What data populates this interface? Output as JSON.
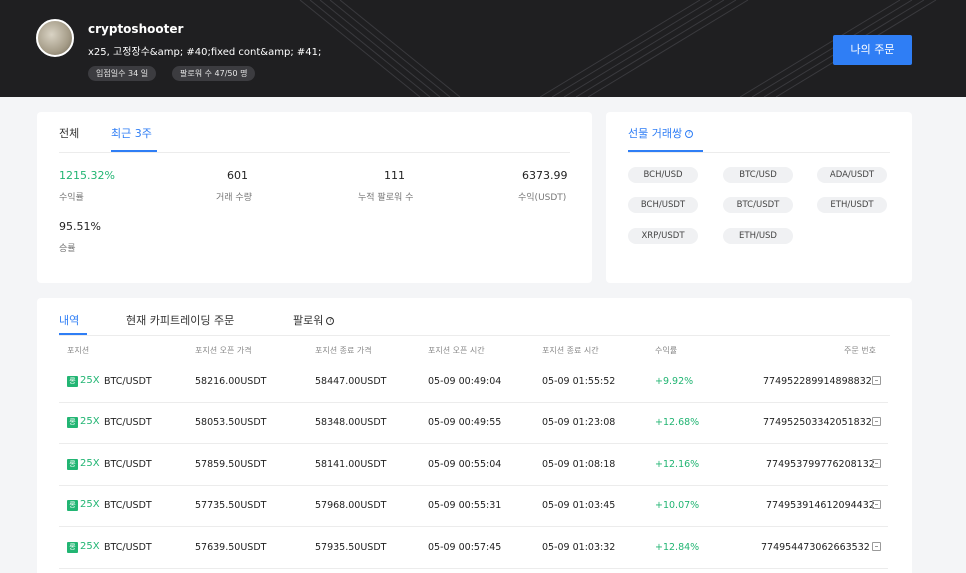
{
  "header": {
    "username": "cryptoshooter",
    "tagline": "x25, 고정장수&amp; #40;fixed cont&amp; #41;",
    "badges": [
      "입점일수 34 일",
      "팔로워 수 47/50 명"
    ],
    "my_orders_button": "나의 주문",
    "accent_color": "#2f7ef5"
  },
  "stats_card": {
    "tabs": [
      "전체",
      "최근 3주"
    ],
    "active_tab": "최근 3주",
    "metrics": [
      {
        "value": "1215.32%",
        "label": "수익률"
      },
      {
        "value": "601",
        "label": "거래 수량"
      },
      {
        "value": "111",
        "label": "누적 팔로워 수"
      },
      {
        "value": "6373.99",
        "label": "수익(USDT)"
      },
      {
        "value": "95.51%",
        "label": "승률"
      }
    ]
  },
  "pairs_card": {
    "title": "선물 거래쌍",
    "help_icon": "question-circle-icon",
    "pairs": [
      "BCH/USD",
      "BTC/USD",
      "ADA/USDT",
      "BCH/USDT",
      "BTC/USDT",
      "ETH/USDT",
      "XRP/USDT",
      "ETH/USD"
    ]
  },
  "history": {
    "tabs": [
      "내역",
      "현재 카피트레이딩 주문",
      "팔로워"
    ],
    "active_tab": "내역",
    "columns": [
      "포지션",
      "포지션 오픈 가격",
      "포지션 종료 가격",
      "포지션 오픈 시간",
      "포지션 종료 시간",
      "수익률",
      "주문 번호"
    ],
    "rows": [
      {
        "side": "롱",
        "leverage": "25X",
        "pair": "BTC/USDT",
        "open_price": "58216.00USDT",
        "close_price": "58447.00USDT",
        "open_time": "05-09 00:49:04",
        "close_time": "05-09 01:55:52",
        "pnl": "+9.92%",
        "order_id": "774952289914898832"
      },
      {
        "side": "롱",
        "leverage": "25X",
        "pair": "BTC/USDT",
        "open_price": "58053.50USDT",
        "close_price": "58348.00USDT",
        "open_time": "05-09 00:49:55",
        "close_time": "05-09 01:23:08",
        "pnl": "+12.68%",
        "order_id": "774952503342051832"
      },
      {
        "side": "롱",
        "leverage": "25X",
        "pair": "BTC/USDT",
        "open_price": "57859.50USDT",
        "close_price": "58141.00USDT",
        "open_time": "05-09 00:55:04",
        "close_time": "05-09 01:08:18",
        "pnl": "+12.16%",
        "order_id": "774953799776208132"
      },
      {
        "side": "롱",
        "leverage": "25X",
        "pair": "BTC/USDT",
        "open_price": "57735.50USDT",
        "close_price": "57968.00USDT",
        "open_time": "05-09 00:55:31",
        "close_time": "05-09 01:03:45",
        "pnl": "+10.07%",
        "order_id": "774953914612094432"
      },
      {
        "side": "롱",
        "leverage": "25X",
        "pair": "BTC/USDT",
        "open_price": "57639.50USDT",
        "close_price": "57935.50USDT",
        "open_time": "05-09 00:57:45",
        "close_time": "05-09 01:03:32",
        "pnl": "+12.84%",
        "order_id": "774954473062663532"
      }
    ]
  }
}
